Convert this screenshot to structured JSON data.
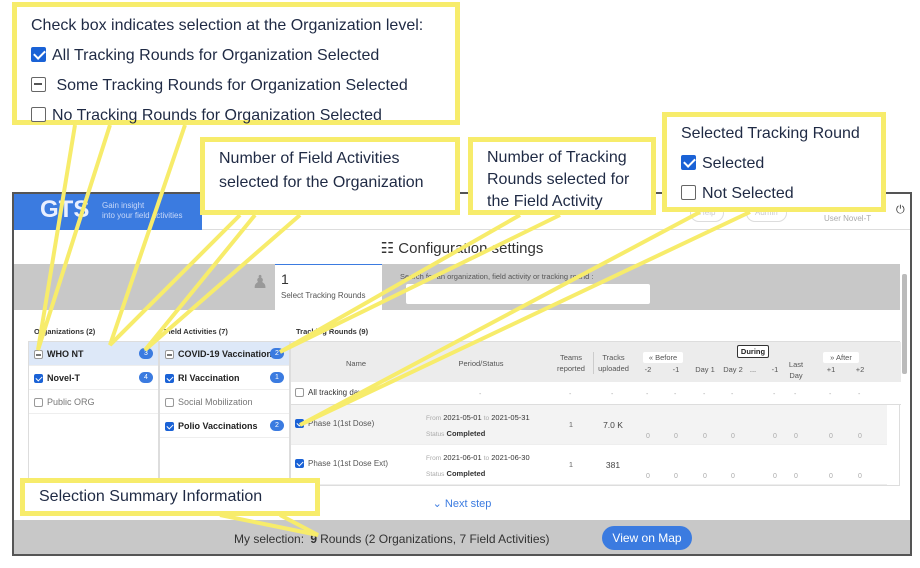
{
  "app": {
    "logo": "GTS",
    "tagline_1": "Gain insight",
    "tagline_2": "into your field activities",
    "help": "Help",
    "admin": "Admin",
    "user": "User Novel-T",
    "title": "Configuration settings"
  },
  "selector": {
    "count": "1",
    "label": "Select Tracking Rounds",
    "search_label": "Search for an organization, field activity or tracking round :",
    "search_value": ""
  },
  "columns": {
    "orgs": "Organizations (2)",
    "fas": "Field Activities (7)",
    "rounds": "Tracking Rounds (9)"
  },
  "orgs": [
    {
      "name": "WHO NT",
      "state": "partial",
      "count": "3"
    },
    {
      "name": "Novel-T",
      "state": "checked",
      "count": "4"
    },
    {
      "name": "Public ORG",
      "state": "unchecked",
      "count": ""
    }
  ],
  "fas": [
    {
      "name": "COVID-19 Vaccination",
      "state": "partial",
      "count": "2"
    },
    {
      "name": "RI Vaccination",
      "state": "checked",
      "count": "1"
    },
    {
      "name": "Social Mobilization",
      "state": "unchecked",
      "count": ""
    },
    {
      "name": "Polio Vaccinations",
      "state": "checked",
      "count": "2"
    }
  ],
  "table": {
    "h_name": "Name",
    "h_period": "Period/Status",
    "h_teams": "Teams reported",
    "h_tracks": "Tracks uploaded",
    "before": "« Before",
    "during": "During",
    "after": "» After",
    "days": [
      "-2",
      "-1",
      "Day 1",
      "Day 2",
      "...",
      "-1",
      "Last Day",
      "+1",
      "+2"
    ],
    "all_label": "All tracking days",
    "dash": "-",
    "rows": [
      {
        "name": "Phase 1(1st Dose)",
        "from": "2021-05-01",
        "to": "2021-05-31",
        "status": "Completed",
        "teams": "1",
        "tracks": "7.0 K",
        "values": [
          "0",
          "0",
          "0",
          "0",
          "0",
          "0",
          "0",
          "0"
        ]
      },
      {
        "name": "Phase 1(1st Dose Ext)",
        "from": "2021-06-01",
        "to": "2021-06-30",
        "status": "Completed",
        "teams": "1",
        "tracks": "381",
        "values": [
          "0",
          "0",
          "0",
          "0",
          "0",
          "0",
          "0",
          "0"
        ]
      }
    ],
    "from_lbl": "From",
    "to_lbl": "to",
    "status_lbl": "Status"
  },
  "next_step": "Next step",
  "summary": {
    "prefix": "My selection:",
    "count": "9",
    "rest": "Rounds (2 Organizations, 7 Field Activities)",
    "button": "View on Map"
  },
  "callouts": {
    "c1_title": "Check box indicates selection at the Organization level:",
    "c1_all": "All Tracking Rounds for Organization Selected",
    "c1_some": "Some Tracking Rounds for Organization Selected",
    "c1_none": "No Tracking Rounds for Organization Selected",
    "c2": "Number of Field Activities selected for the Organization",
    "c3": "Number of Tracking Rounds selected for the Field Activity",
    "c4_title": "Selected Tracking Round",
    "c4_sel": "Selected",
    "c4_not": "Not Selected",
    "c5": "Selection Summary Information"
  },
  "colors": {
    "accent": "#3b7be0",
    "callout_border": "#f7ec6b"
  }
}
